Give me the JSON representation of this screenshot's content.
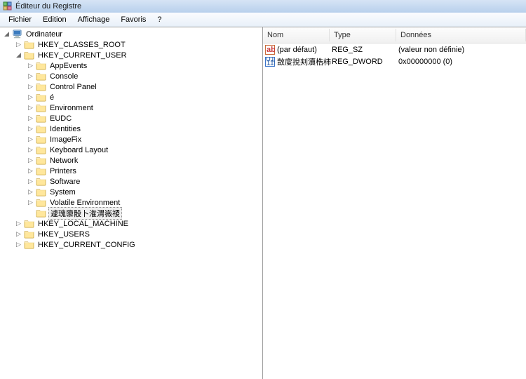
{
  "title": "Éditeur du Registre",
  "menu": [
    "Fichier",
    "Edition",
    "Affichage",
    "Favoris",
    "?"
  ],
  "tree": {
    "root": "Ordinateur",
    "hives": [
      {
        "name": "HKEY_CLASSES_ROOT",
        "expanded": false,
        "children": []
      },
      {
        "name": "HKEY_CURRENT_USER",
        "expanded": true,
        "children": [
          {
            "name": "AppEvents"
          },
          {
            "name": "Console"
          },
          {
            "name": "Control Panel"
          },
          {
            "name": "é"
          },
          {
            "name": "Environment"
          },
          {
            "name": "EUDC"
          },
          {
            "name": "Identities"
          },
          {
            "name": "ImageFix"
          },
          {
            "name": "Keyboard Layout"
          },
          {
            "name": "Network"
          },
          {
            "name": "Printers"
          },
          {
            "name": "Software"
          },
          {
            "name": "System"
          },
          {
            "name": "Volatile Environment"
          },
          {
            "name": "遽瑰隳骰卜潅渭嶶禝",
            "selected": true
          }
        ]
      },
      {
        "name": "HKEY_LOCAL_MACHINE",
        "expanded": false,
        "children": []
      },
      {
        "name": "HKEY_USERS",
        "expanded": false,
        "children": []
      },
      {
        "name": "HKEY_CURRENT_CONFIG",
        "expanded": false,
        "children": []
      }
    ]
  },
  "list": {
    "headers": {
      "nom": "Nom",
      "type": "Type",
      "data": "Données"
    },
    "rows": [
      {
        "icon": "string",
        "nom": "(par défaut)",
        "type": "REG_SZ",
        "data": "(valeur non définie)"
      },
      {
        "icon": "binary",
        "nom": "敳廀挩刾瀆梏柿",
        "type": "REG_DWORD",
        "data": "0x00000000 (0)"
      }
    ]
  }
}
